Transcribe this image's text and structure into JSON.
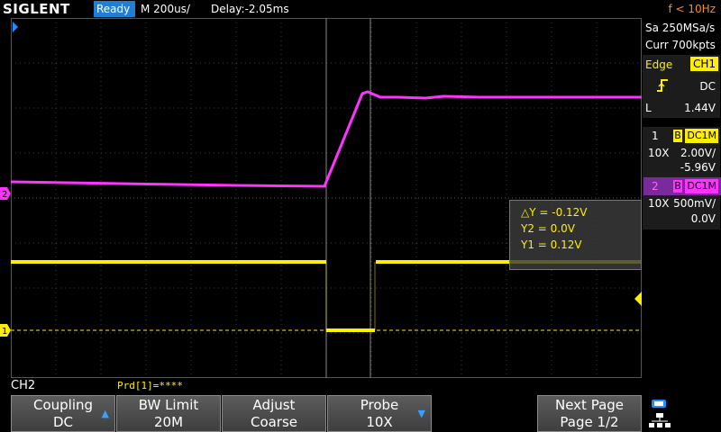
{
  "topbar": {
    "logo": "SIGLENT",
    "status": "Ready",
    "timebase": "M 200us/",
    "delay": "Delay:-2.05ms",
    "frequency": "f < 10Hz"
  },
  "right_panel": {
    "sample_rate": "Sa 250MSa/s",
    "memory_depth": "Curr 700kpts",
    "trigger": {
      "label": "Edge",
      "source": "CH1",
      "slope_icon": "rising-edge-icon",
      "coupling": "DC",
      "level_label": "L",
      "level": "1.44V"
    },
    "ch1": {
      "number": "1",
      "badge": "B",
      "coupling": "DC1M",
      "probe": "10X",
      "scale": "2.00V/",
      "offset": "-5.96V",
      "color": "#ffee00"
    },
    "ch2": {
      "number": "2",
      "badge": "B",
      "coupling": "DC1M",
      "probe": "10X",
      "scale": "500mV/",
      "offset": "0.0V",
      "color": "#ff33ff"
    }
  },
  "cursor": {
    "delta_y": "△Y = -0.12V",
    "y2": "Y2 = 0.0V",
    "y1": "Y1 = 0.12V"
  },
  "markers": {
    "ch1": "1",
    "ch2": "2"
  },
  "bottom": {
    "active_channel": "CH2",
    "prd": "Prd[1]=****"
  },
  "softkeys": [
    {
      "line1": "Coupling",
      "line2": "DC",
      "arrow": "▲"
    },
    {
      "line1": "BW Limit",
      "line2": "20M",
      "arrow": ""
    },
    {
      "line1": "Adjust",
      "line2": "Coarse",
      "arrow": ""
    },
    {
      "line1": "Probe",
      "line2": "10X",
      "arrow": "▼"
    },
    {
      "line1": "Next Page",
      "line2": "Page 1/2",
      "arrow": ""
    }
  ],
  "colors": {
    "ch1": "#ffee00",
    "ch2": "#ff33ff",
    "ready": "#1f7fd4",
    "freq": "#ff8c1a",
    "grid": "#3a3a3a"
  }
}
